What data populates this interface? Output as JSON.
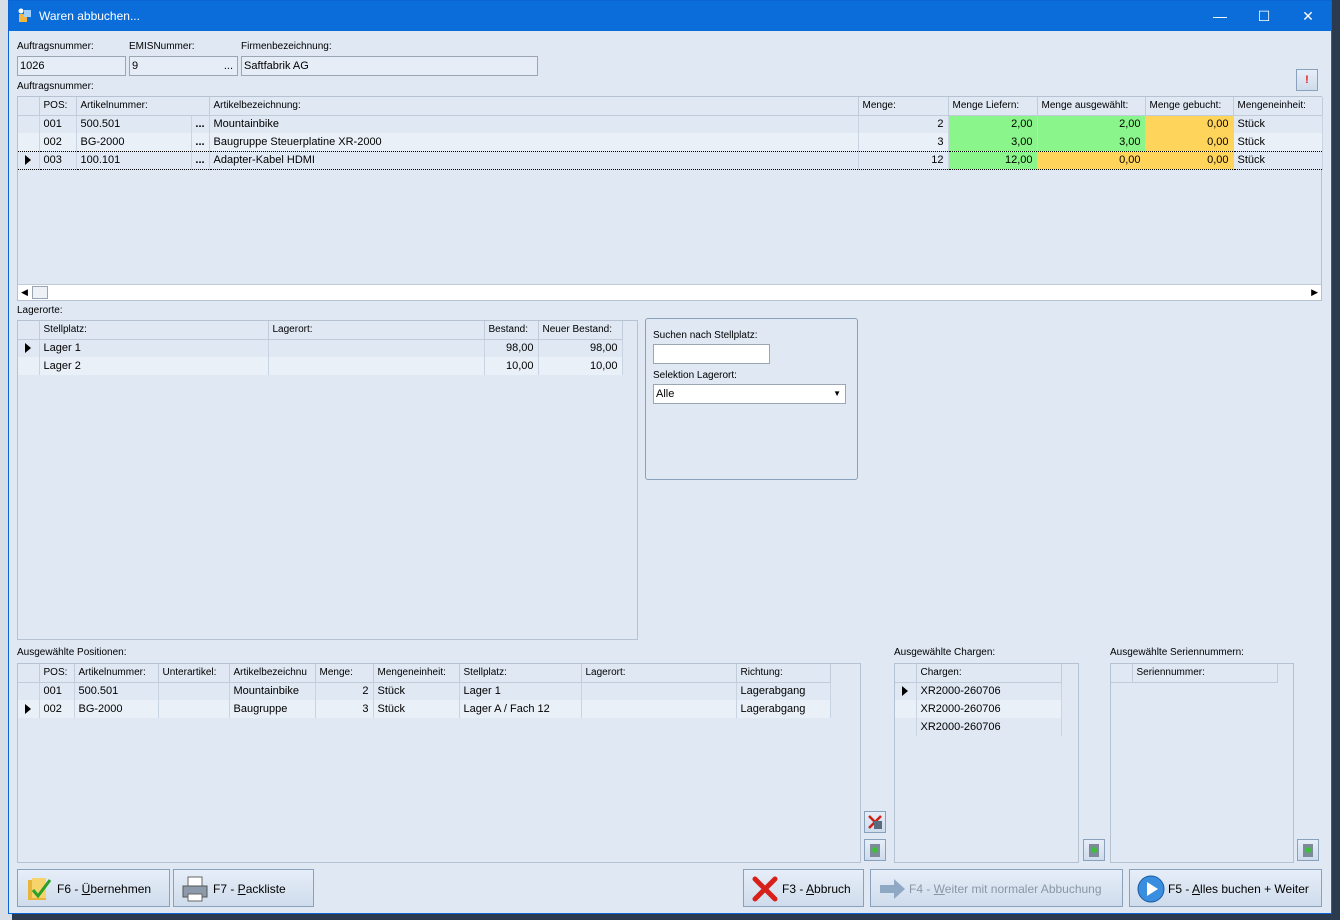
{
  "window": {
    "title": "Waren abbuchen..."
  },
  "header": {
    "auftrag_label": "Auftragsnummer:",
    "auftrag_value": "1026",
    "emis_label": "EMISNummer:",
    "emis_value": "9",
    "emis_dots": "...",
    "firma_label": "Firmenbezeichnung:",
    "firma_value": "Saftfabrik AG",
    "grid_label": "Auftragsnummer:"
  },
  "positions": {
    "columns": [
      "POS:",
      "Artikelnummer:",
      "Artikelbezeichnung:",
      "Menge:",
      "Menge Liefern:",
      "Menge ausgewählt:",
      "Menge gebucht:",
      "Mengeneinheit:"
    ],
    "rows": [
      {
        "pos": "001",
        "artnr": "500.501",
        "dots": "...",
        "bez": "Mountainbike",
        "menge": "2",
        "liefern": "2,00",
        "ausgewaehlt": "2,00",
        "gebucht": "0,00",
        "einheit": "Stück"
      },
      {
        "pos": "002",
        "artnr": "BG-2000",
        "dots": "...",
        "bez": "Baugruppe Steuerplatine XR-2000",
        "menge": "3",
        "liefern": "3,00",
        "ausgewaehlt": "3,00",
        "gebucht": "0,00",
        "einheit": "Stück"
      },
      {
        "pos": "003",
        "artnr": "100.101",
        "dots": "...",
        "bez": "Adapter-Kabel HDMI",
        "menge": "12",
        "liefern": "12,00",
        "ausgewaehlt": "0,00",
        "gebucht": "0,00",
        "einheit": "Stück"
      }
    ]
  },
  "lagerorte": {
    "label": "Lagerorte:",
    "columns": [
      "Stellplatz:",
      "Lagerort:",
      "Bestand:",
      "Neuer Bestand:"
    ],
    "rows": [
      {
        "stellplatz": "Lager 1",
        "lagerort": "",
        "bestand": "98,00",
        "neu": "98,00"
      },
      {
        "stellplatz": "Lager 2",
        "lagerort": "",
        "bestand": "10,00",
        "neu": "10,00"
      }
    ]
  },
  "search": {
    "stellplatz_label": "Suchen nach Stellplatz:",
    "stellplatz_value": "",
    "selektion_label": "Selektion Lagerort:",
    "selektion_value": "Alle"
  },
  "selected_positions": {
    "label": "Ausgewählte Positionen:",
    "columns": [
      "POS:",
      "Artikelnummer:",
      "Unterartikel:",
      "Artikelbezeichnu",
      "Menge:",
      "Mengeneinheit:",
      "Stellplatz:",
      "Lagerort:",
      "Richtung:"
    ],
    "rows": [
      {
        "pos": "001",
        "artnr": "500.501",
        "unter": "",
        "bez": "Mountainbike",
        "menge": "2",
        "einheit": "Stück",
        "stellplatz": "Lager 1",
        "lagerort": "",
        "richtung": "Lagerabgang"
      },
      {
        "pos": "002",
        "artnr": "BG-2000",
        "unter": "",
        "bez": "Baugruppe",
        "menge": "3",
        "einheit": "Stück",
        "stellplatz": "Lager A / Fach 12",
        "lagerort": "",
        "richtung": "Lagerabgang"
      }
    ]
  },
  "chargen": {
    "label": "Ausgewählte Chargen:",
    "column": "Chargen:",
    "rows": [
      "XR2000-260706",
      "XR2000-260706",
      "XR2000-260706"
    ]
  },
  "serien": {
    "label": "Ausgewählte Seriennummern:",
    "column": "Seriennummer:"
  },
  "buttons": {
    "f6_key": "F6 - ",
    "f6_u": "Ü",
    "f6_rest": "bernehmen",
    "f7_key": "F7 - ",
    "f7_u": "P",
    "f7_rest": "ackliste",
    "f3_key": "F3 - ",
    "f3_u": "A",
    "f3_rest": "bbruch",
    "f4_key": "F4 - ",
    "f4_u": "W",
    "f4_rest": "eiter mit normaler Abbuchung",
    "f5_key": "F5 - ",
    "f5_u": "A",
    "f5_rest": "lles buchen + Weiter"
  },
  "colors": {
    "titlebar": "#0a6dd9",
    "green": "#8af58a",
    "orange": "#ffd45a"
  }
}
